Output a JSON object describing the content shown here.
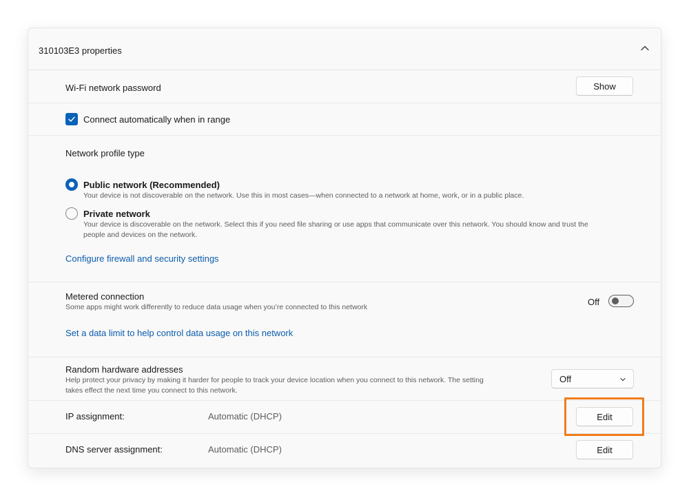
{
  "header": {
    "title": "310103E3 properties",
    "collapse_icon": "chevron-up-icon"
  },
  "wifi_password": {
    "label": "Wi-Fi network password",
    "button_label": "Show"
  },
  "auto_connect": {
    "label": "Connect automatically when in range",
    "checked": true
  },
  "profile": {
    "heading": "Network profile type",
    "options": [
      {
        "label": "Public network (Recommended)",
        "description": "Your device is not discoverable on the network. Use this in most cases—when connected to a network at home, work, or in a public place.",
        "selected": true
      },
      {
        "label": "Private network",
        "description_line1": "Your device is discoverable on the network. Select this if you need file sharing or use apps that communicate over this network. You should know and trust the",
        "description_line2": "people and devices on the network.",
        "selected": false
      }
    ],
    "firewall_link": "Configure firewall and security settings"
  },
  "metered": {
    "label": "Metered connection",
    "description": "Some apps might work differently to reduce data usage when you’re connected to this network",
    "toggle_state": "Off",
    "data_limit_link": "Set a data limit to help control data usage on this network"
  },
  "random_hw": {
    "label": "Random hardware addresses",
    "description_line1": "Help protect your privacy by making it harder for people to track your device location when you connect to this network. The setting",
    "description_line2": "takes effect the next time you connect to this network.",
    "selected_value": "Off"
  },
  "ip_assignment": {
    "label": "IP assignment:",
    "value": "Automatic (DHCP)",
    "button_label": "Edit"
  },
  "dns_assignment": {
    "label": "DNS server assignment:",
    "value": "Automatic (DHCP)",
    "button_label": "Edit"
  },
  "colors": {
    "accent": "#0a62b8",
    "link": "#0b5cad",
    "highlight": "#f07d1a"
  }
}
